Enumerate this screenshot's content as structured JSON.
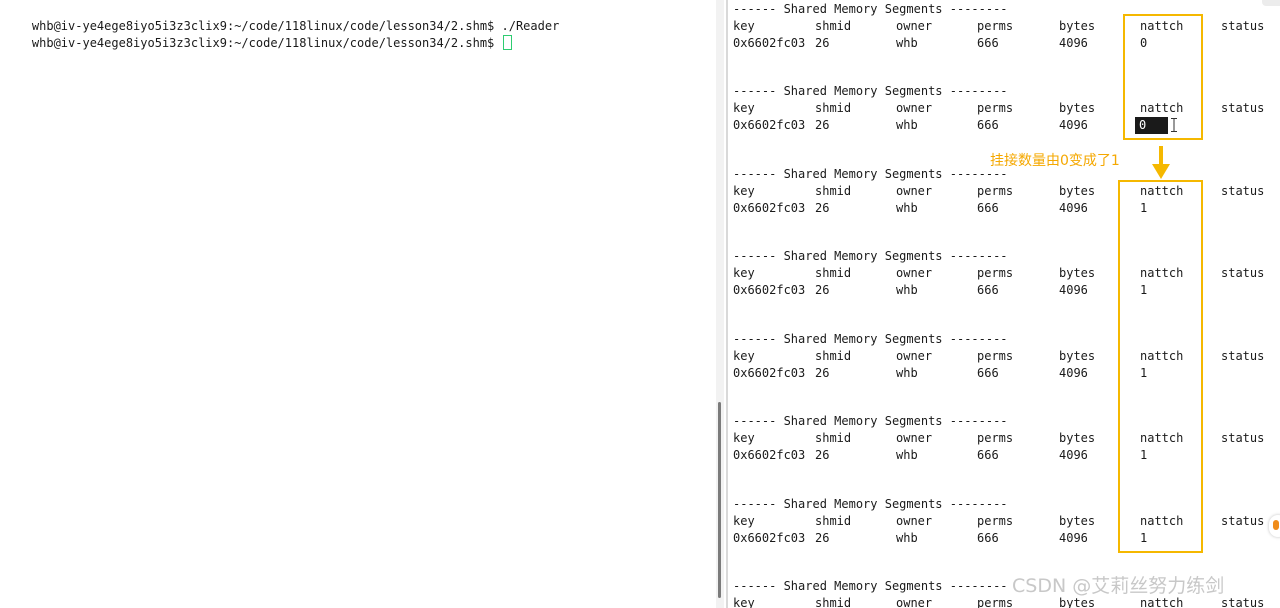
{
  "left_terminal": {
    "lines": [
      {
        "prompt": "whb@iv-ye4ege8iyo5i3z3clix9:~/code/118linux/code/lesson34/2.shm$",
        "command": " ./Reader"
      },
      {
        "prompt": "whb@iv-ye4ege8iyo5i3z3clix9:~/code/118linux/code/lesson34/2.shm$",
        "command": " "
      }
    ]
  },
  "right_terminal": {
    "header": "------ Shared Memory Segments --------",
    "columns": [
      "key",
      "shmid",
      "owner",
      "perms",
      "bytes",
      "nattch",
      "status"
    ],
    "segments": [
      {
        "key": "0x6602fc03",
        "shmid": "26",
        "owner": "whb",
        "perms": "666",
        "bytes": "4096",
        "nattch": "0"
      },
      {
        "key": "0x6602fc03",
        "shmid": "26",
        "owner": "whb",
        "perms": "666",
        "bytes": "4096",
        "nattch": "0"
      },
      {
        "key": "0x6602fc03",
        "shmid": "26",
        "owner": "whb",
        "perms": "666",
        "bytes": "4096",
        "nattch": "1"
      },
      {
        "key": "0x6602fc03",
        "shmid": "26",
        "owner": "whb",
        "perms": "666",
        "bytes": "4096",
        "nattch": "1"
      },
      {
        "key": "0x6602fc03",
        "shmid": "26",
        "owner": "whb",
        "perms": "666",
        "bytes": "4096",
        "nattch": "1"
      },
      {
        "key": "0x6602fc03",
        "shmid": "26",
        "owner": "whb",
        "perms": "666",
        "bytes": "4096",
        "nattch": "1"
      },
      {
        "key": "0x6602fc03",
        "shmid": "26",
        "owner": "whb",
        "perms": "666",
        "bytes": "4096",
        "nattch": "1"
      },
      {
        "key": "",
        "shmid": "",
        "owner": "",
        "perms": "",
        "bytes": "",
        "nattch": ""
      }
    ]
  },
  "annotation": {
    "text": "挂接数量由0变成了1",
    "color": "#f5b800"
  },
  "watermark": "CSDN @艾莉丝努力练剑",
  "icons": {
    "arrow": "arrow-down-icon",
    "text_cursor": "i-beam-icon"
  }
}
